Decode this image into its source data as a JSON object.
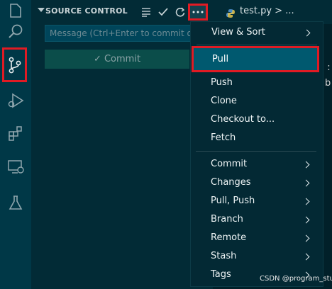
{
  "sidebar": {
    "title": "SOURCE CONTROL",
    "message_placeholder": "Message (Ctrl+Enter to commit o...",
    "commit_label": "✓ Commit"
  },
  "editor": {
    "tab_label": "test.py > ...",
    "fragment_1": ") :",
    "fragment_2": "b"
  },
  "menu": {
    "items": [
      {
        "label": "View & Sort",
        "submenu": true
      },
      {
        "label": "Pull",
        "submenu": false
      },
      {
        "label": "Push",
        "submenu": false
      },
      {
        "label": "Clone",
        "submenu": false
      },
      {
        "label": "Checkout to...",
        "submenu": false
      },
      {
        "label": "Fetch",
        "submenu": false
      },
      {
        "label": "Commit",
        "submenu": true
      },
      {
        "label": "Changes",
        "submenu": true
      },
      {
        "label": "Pull, Push",
        "submenu": true
      },
      {
        "label": "Branch",
        "submenu": true
      },
      {
        "label": "Remote",
        "submenu": true
      },
      {
        "label": "Stash",
        "submenu": true
      },
      {
        "label": "Tags",
        "submenu": true
      }
    ]
  },
  "watermark": "CSDN @program_study",
  "colors": {
    "highlight": "#e01b24",
    "selected": "#00596f"
  }
}
